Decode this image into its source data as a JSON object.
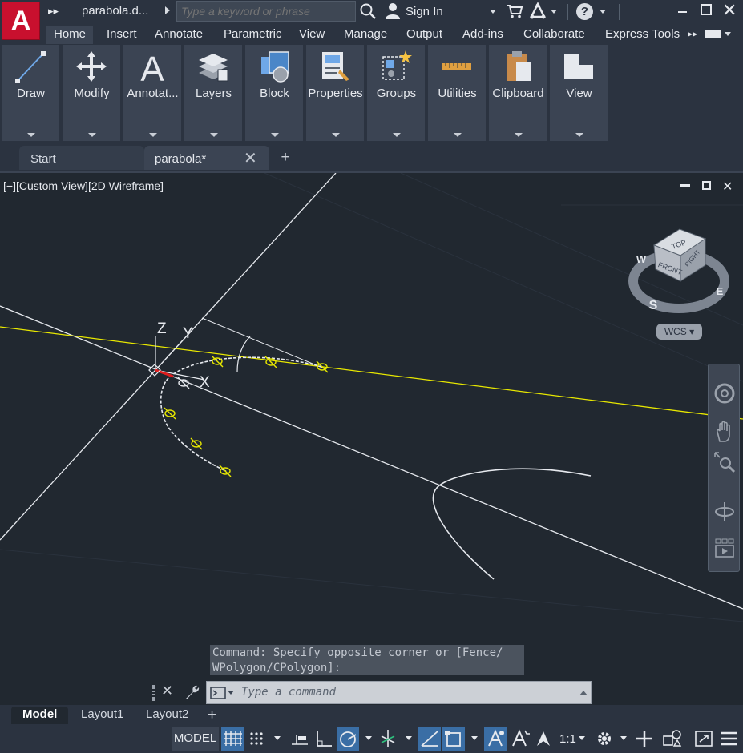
{
  "app": {
    "logo_letter": "A",
    "doc_title": "parabola.d...",
    "search_placeholder": "Type a keyword or phrase",
    "sign_in": "Sign In",
    "help": "?"
  },
  "ribbon_tabs": [
    "Home",
    "Insert",
    "Annotate",
    "Parametric",
    "View",
    "Manage",
    "Output",
    "Add-ins",
    "Collaborate",
    "Express Tools"
  ],
  "ribbon_panels": [
    {
      "label": "Draw",
      "icon": "draw-line-icon"
    },
    {
      "label": "Modify",
      "icon": "move-arrows-icon"
    },
    {
      "label": "Annotat...",
      "icon": "text-a-icon"
    },
    {
      "label": "Layers",
      "icon": "layers-icon"
    },
    {
      "label": "Block",
      "icon": "block-icon"
    },
    {
      "label": "Properties",
      "icon": "properties-icon"
    },
    {
      "label": "Groups",
      "icon": "groups-icon"
    },
    {
      "label": "Utilities",
      "icon": "ruler-icon"
    },
    {
      "label": "Clipboard",
      "icon": "clipboard-icon"
    },
    {
      "label": "View",
      "icon": "view-icon"
    }
  ],
  "file_tabs": {
    "start": "Start",
    "active": "parabola*"
  },
  "viewport": {
    "label": "[−][Custom View][2D Wireframe]",
    "viewcube": {
      "top": "TOP",
      "front": "FRONT",
      "right": "RIGHT",
      "compass": {
        "w": "W",
        "s": "S",
        "e": "E"
      }
    },
    "wcs": "WCS",
    "ucs": {
      "x": "X",
      "y": "Y",
      "z": "Z"
    }
  },
  "command": {
    "history_line1": "Command: Specify opposite corner or [Fence/",
    "history_line2": "WPolygon/CPolygon]:",
    "placeholder": "Type a command"
  },
  "layout_tabs": [
    "Model",
    "Layout1",
    "Layout2"
  ],
  "status": {
    "model": "MODEL",
    "scale": "1:1"
  },
  "colors": {
    "accent_blue": "#3a6ea5",
    "logo_red": "#c8102e",
    "grip_yellow": "#e8e800"
  }
}
